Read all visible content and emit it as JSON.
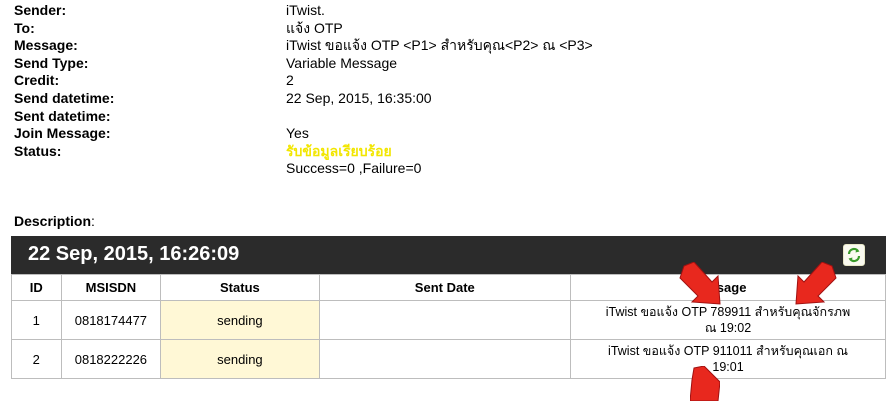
{
  "details": [
    {
      "label": "Sender",
      "value": "iTwist.",
      "highlight": false
    },
    {
      "label": "To",
      "value": "แจ้ง OTP",
      "highlight": false
    },
    {
      "label": "Message",
      "value": "iTwist ขอแจ้ง OTP <P1> สำหรับคุณ<P2> ณ <P3>",
      "highlight": false
    },
    {
      "label": "Send Type",
      "value": "Variable Message",
      "highlight": false
    },
    {
      "label": "Credit",
      "value": "2",
      "highlight": false
    },
    {
      "label": "Send datetime",
      "value": "22 Sep, 2015, 16:35:00",
      "highlight": false
    },
    {
      "label": "Sent datetime",
      "value": "",
      "highlight": false
    },
    {
      "label": "Join Message",
      "value": "Yes",
      "highlight": false
    },
    {
      "label": "Status",
      "value": "รับข้อมูลเรียบร้อย",
      "highlight": true
    },
    {
      "label": "",
      "value": "Success=0  ,Failure=0",
      "highlight": false
    }
  ],
  "description_label": "Description",
  "panel": {
    "title": "22 Sep, 2015, 16:26:09",
    "refresh_icon": "refresh-icon"
  },
  "table": {
    "headers": [
      "ID",
      "MSISDN",
      "Status",
      "Sent Date",
      "ssage"
    ],
    "rows": [
      {
        "id": "1",
        "msisdn": "0818174477",
        "status": "sending",
        "sent_date": "",
        "message_line1": "iTwist ขอแจ้ง OTP 789911 สำหรับคุณจักรภพ",
        "message_line2": "ณ 19:02"
      },
      {
        "id": "2",
        "msisdn": "0818222226",
        "status": "sending",
        "sent_date": "",
        "message_line1": "iTwist ขอแจ้ง OTP 911011 สำหรับคุณเอก ณ",
        "message_line2": "19:01"
      }
    ]
  },
  "colors": {
    "status_highlight": "#f2e600",
    "header_bg": "#2b2b2b",
    "status_cell_bg": "#fff8d6",
    "annotation_arrow": "#e8281e"
  }
}
